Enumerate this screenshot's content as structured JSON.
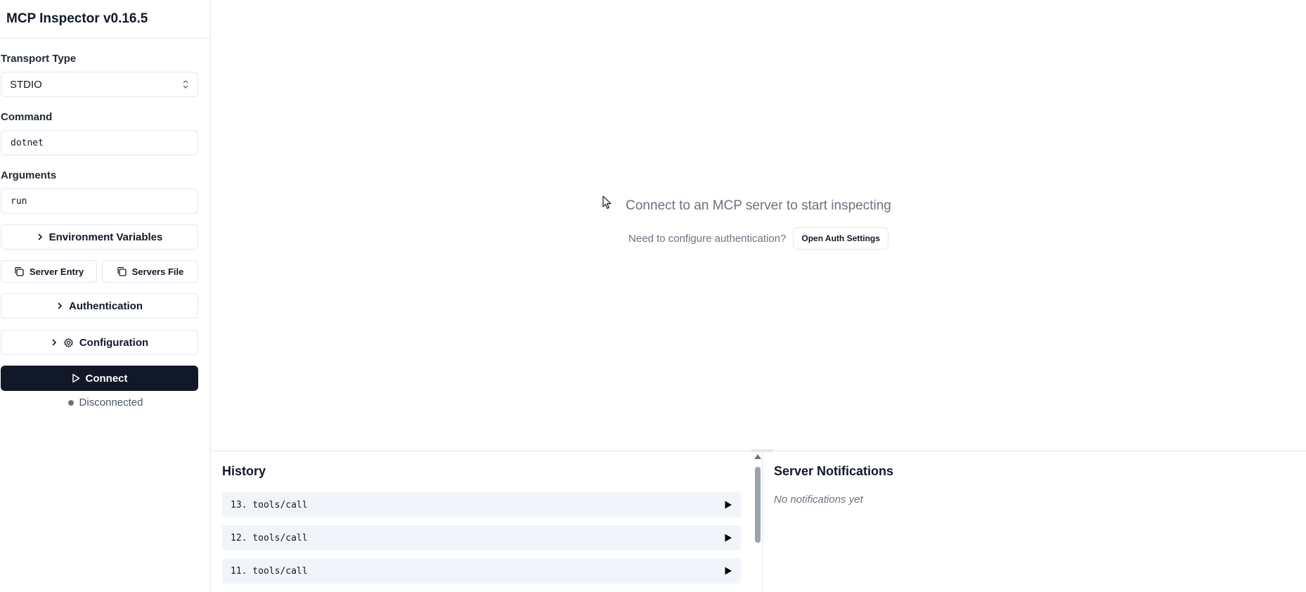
{
  "app": {
    "title": "MCP Inspector v0.16.5"
  },
  "sidebar": {
    "transport": {
      "label": "Transport Type",
      "value": "STDIO"
    },
    "command": {
      "label": "Command",
      "value": "dotnet"
    },
    "arguments": {
      "label": "Arguments",
      "value": "run"
    },
    "env_label": "Environment Variables",
    "server_entry_label": "Server Entry",
    "servers_file_label": "Servers File",
    "auth_label": "Authentication",
    "config_label": "Configuration",
    "connect_label": "Connect",
    "status": "Disconnected"
  },
  "main": {
    "message": "Connect to an MCP server to start inspecting",
    "auth_prompt": "Need to configure authentication?",
    "auth_button": "Open Auth Settings"
  },
  "history": {
    "title": "History",
    "items": [
      {
        "label": "13. tools/call"
      },
      {
        "label": "12. tools/call"
      },
      {
        "label": "11. tools/call"
      }
    ]
  },
  "notifications": {
    "title": "Server Notifications",
    "empty": "No notifications yet"
  },
  "colors": {
    "primary": "#111827",
    "muted": "#6b7280",
    "border": "#e2e8f0",
    "row_bg": "#f1f5f9"
  }
}
